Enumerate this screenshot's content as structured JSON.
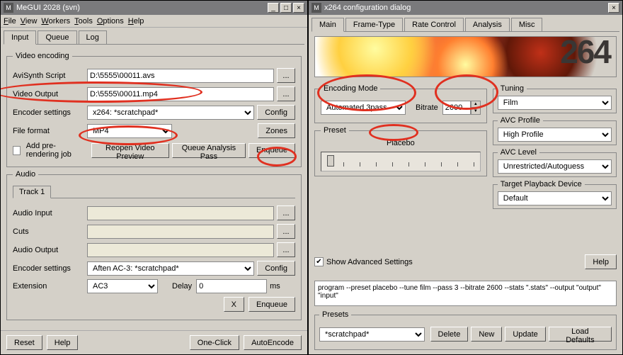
{
  "left": {
    "title": "MeGUI 2028 (svn)",
    "menus": [
      "File",
      "View",
      "Workers",
      "Tools",
      "Options",
      "Help"
    ],
    "tabs": [
      "Input",
      "Queue",
      "Log"
    ],
    "video": {
      "legend": "Video encoding",
      "avisynth_label": "AviSynth Script",
      "avisynth_value": "D:\\5555\\00011.avs",
      "video_output_label": "Video Output",
      "video_output_value": "D:\\5555\\00011.mp4",
      "encoder_label": "Encoder settings",
      "encoder_value": "x264: *scratchpad*",
      "config_label": "Config",
      "fileformat_label": "File format",
      "fileformat_value": "MP4",
      "zones_label": "Zones",
      "prerender_label": "Add pre-rendering job",
      "reopen_label": "Reopen Video Preview",
      "queueanalysis_label": "Queue Analysis Pass",
      "enqueue_label": "Enqueue"
    },
    "audio": {
      "legend": "Audio",
      "track_tab": "Track 1",
      "input_label": "Audio Input",
      "cuts_label": "Cuts",
      "output_label": "Audio Output",
      "encoder_label": "Encoder settings",
      "encoder_value": "Aften AC-3: *scratchpad*",
      "config_label": "Config",
      "extension_label": "Extension",
      "extension_value": "AC3",
      "delay_label": "Delay",
      "delay_value": "0",
      "ms_label": "ms",
      "x_label": "X",
      "enqueue_label": "Enqueue"
    },
    "bottom": {
      "reset": "Reset",
      "help": "Help",
      "oneclick": "One-Click",
      "autoencode": "AutoEncode"
    },
    "browse_btn": "..."
  },
  "right": {
    "title": "x264 configuration dialog",
    "tabs": [
      "Main",
      "Frame-Type",
      "Rate Control",
      "Analysis",
      "Misc"
    ],
    "banner_text": "264",
    "encoding_mode": {
      "legend": "Encoding Mode",
      "value": "Automated 3pass",
      "bitrate_label": "Bitrate",
      "bitrate_value": "2600"
    },
    "preset": {
      "legend": "Preset",
      "label": "Placebo"
    },
    "tuning": {
      "legend": "Tuning",
      "value": "Film"
    },
    "avc_profile": {
      "legend": "AVC Profile",
      "value": "High Profile"
    },
    "avc_level": {
      "legend": "AVC Level",
      "value": "Unrestricted/Autoguess"
    },
    "target_device": {
      "legend": "Target Playback Device",
      "value": "Default"
    },
    "advanced_label": "Show Advanced Settings",
    "help_label": "Help",
    "cmdline": "program --preset placebo --tune film --pass 3 --bitrate 2600 --stats \".stats\" --output \"output\" \"input\"",
    "presets": {
      "legend": "Presets",
      "value": "*scratchpad*",
      "delete": "Delete",
      "new": "New",
      "update": "Update",
      "load_defaults": "Load Defaults"
    }
  }
}
